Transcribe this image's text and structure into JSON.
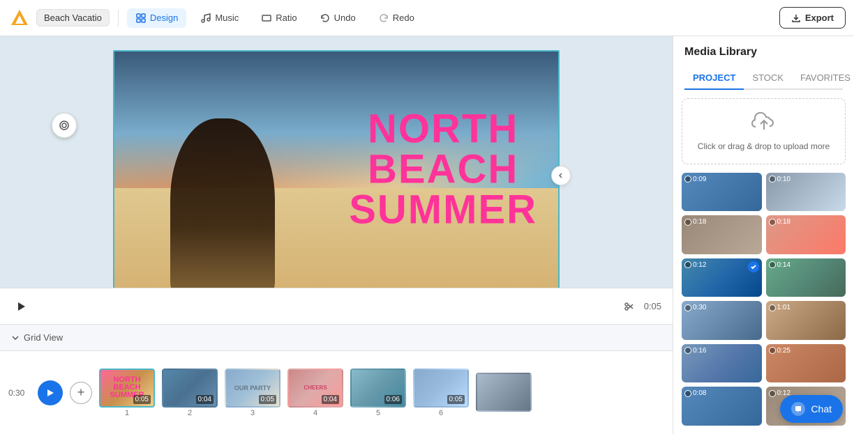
{
  "topbar": {
    "project_name": "Beach Vacatio",
    "design_label": "Design",
    "music_label": "Music",
    "ratio_label": "Ratio",
    "undo_label": "Undo",
    "redo_label": "Redo",
    "export_label": "Export"
  },
  "canvas": {
    "text_line1": "NORTH",
    "text_line2": "BEACH",
    "text_line3": "SUMMER",
    "duration": "0:05"
  },
  "grid_view": {
    "label": "Grid View"
  },
  "timeline": {
    "time": "0:30",
    "clips": [
      {
        "id": 1,
        "duration": "0:05",
        "bg": "clip-bg-1"
      },
      {
        "id": 2,
        "duration": "0:04",
        "bg": "clip-bg-2"
      },
      {
        "id": 3,
        "duration": "0:05",
        "bg": "clip-bg-3"
      },
      {
        "id": 4,
        "duration": "0:04",
        "bg": "clip-bg-4"
      },
      {
        "id": 5,
        "duration": "0:06",
        "bg": "clip-bg-5"
      },
      {
        "id": 6,
        "duration": "0:05",
        "bg": "clip-bg-6"
      },
      {
        "id": 7,
        "duration": "",
        "bg": "clip-bg-7"
      }
    ]
  },
  "media_library": {
    "title": "Media Library",
    "tabs": [
      "PROJECT",
      "STOCK",
      "FAVORITES"
    ],
    "active_tab": "PROJECT",
    "upload_text": "Click or drag & drop\nto upload more",
    "items": [
      {
        "id": 1,
        "duration": "0:09",
        "bg": "media-bg-1",
        "checked": false
      },
      {
        "id": 2,
        "duration": "0:10",
        "bg": "media-bg-2",
        "checked": false
      },
      {
        "id": 3,
        "duration": "0:18",
        "bg": "media-bg-3",
        "checked": false
      },
      {
        "id": 4,
        "duration": "0:18",
        "bg": "media-bg-4",
        "checked": false
      },
      {
        "id": 5,
        "duration": "0:12",
        "bg": "media-bg-5",
        "checked": true
      },
      {
        "id": 6,
        "duration": "0:14",
        "bg": "media-bg-6",
        "checked": false
      },
      {
        "id": 7,
        "duration": "0:30",
        "bg": "media-bg-7",
        "checked": false
      },
      {
        "id": 8,
        "duration": "1:01",
        "bg": "media-bg-8",
        "checked": false
      },
      {
        "id": 9,
        "duration": "0:16",
        "bg": "media-bg-9",
        "checked": false
      },
      {
        "id": 10,
        "duration": "0:25",
        "bg": "media-bg-10",
        "checked": false
      },
      {
        "id": 11,
        "duration": "0:08",
        "bg": "media-bg-1",
        "checked": false
      },
      {
        "id": 12,
        "duration": "0:12",
        "bg": "media-bg-3",
        "checked": false
      }
    ]
  },
  "chat": {
    "label": "Chat"
  }
}
